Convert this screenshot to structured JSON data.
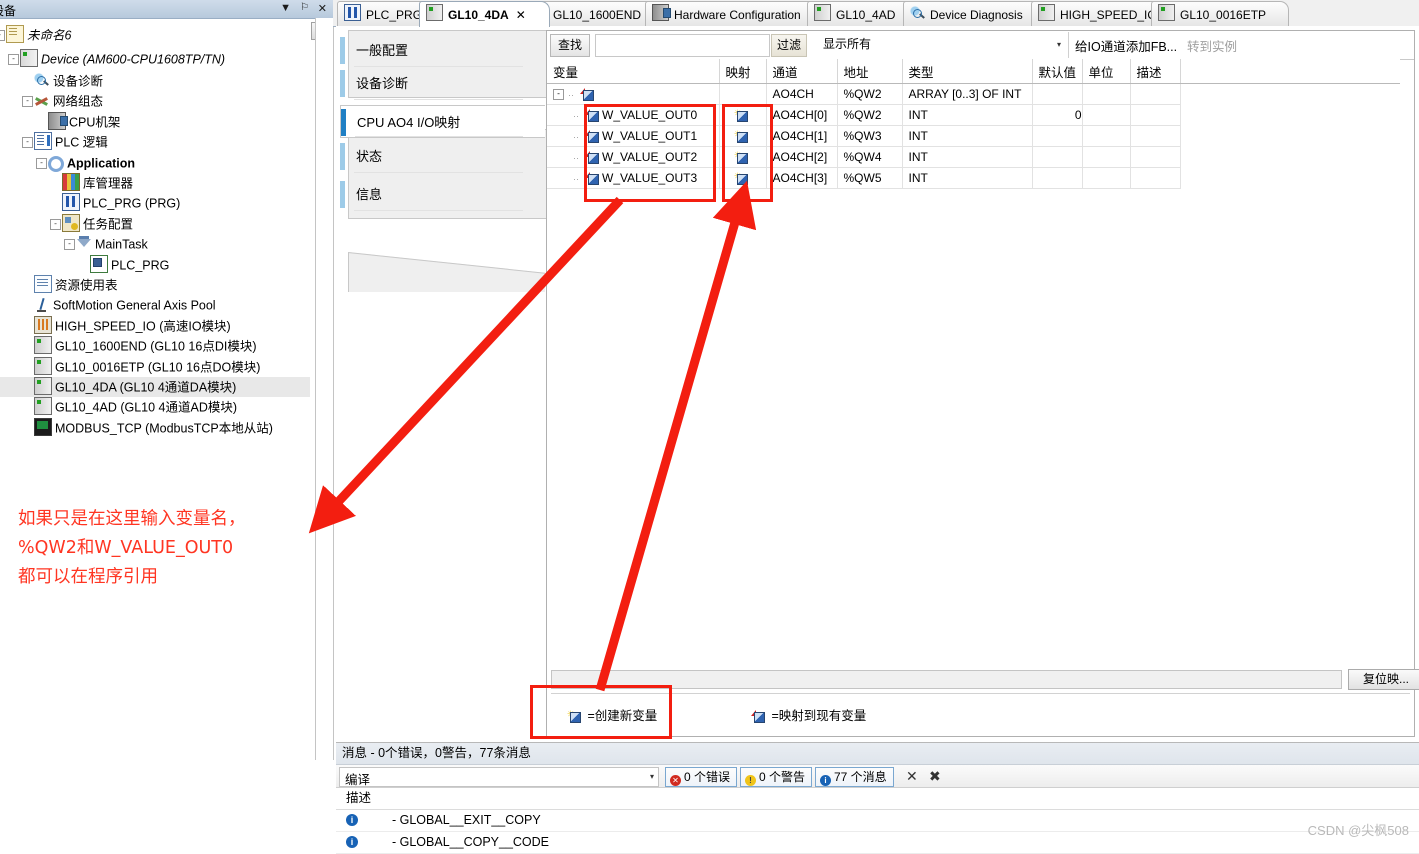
{
  "tree_panel": {
    "title": "设备",
    "controls": [
      "▼",
      "⚐",
      "✕"
    ],
    "scroll_button": "▼",
    "nodes": [
      {
        "label": "未命名6",
        "icon": "document-icon",
        "indent": 0,
        "expander": "-",
        "italic": true
      },
      {
        "label": "Device (AM600-CPU1608TP/TN)",
        "icon": "device-icon",
        "indent": 1,
        "expander": "-",
        "italic": true
      },
      {
        "label": "设备诊断",
        "icon": "diagnosis-magnifier-icon",
        "indent": 2,
        "expander": "",
        "italic": false
      },
      {
        "label": "网络组态",
        "icon": "network-config-icon",
        "indent": 2,
        "expander": "-",
        "italic": false
      },
      {
        "label": "CPU机架",
        "icon": "cpu-rack-icon",
        "indent": 3,
        "expander": "",
        "italic": false
      },
      {
        "label": "PLC 逻辑",
        "icon": "plc-logic-icon",
        "indent": 2,
        "expander": "-",
        "italic": false
      },
      {
        "label": "Application",
        "icon": "application-icon",
        "indent": 3,
        "expander": "-",
        "italic": false,
        "bold": true
      },
      {
        "label": "库管理器",
        "icon": "library-manager-icon",
        "indent": 4,
        "expander": "",
        "italic": false
      },
      {
        "label": "PLC_PRG (PRG)",
        "icon": "program-icon",
        "indent": 4,
        "expander": "",
        "italic": false
      },
      {
        "label": "任务配置",
        "icon": "task-config-icon",
        "indent": 4,
        "expander": "-",
        "italic": false
      },
      {
        "label": "MainTask",
        "icon": "main-task-icon",
        "indent": 5,
        "expander": "-",
        "italic": false
      },
      {
        "label": "PLC_PRG",
        "icon": "task-program-icon",
        "indent": 6,
        "expander": "",
        "italic": false
      },
      {
        "label": "资源使用表",
        "icon": "resource-table-icon",
        "indent": 2,
        "expander": "",
        "italic": false
      },
      {
        "label": "SoftMotion General Axis Pool",
        "icon": "axis-pool-icon",
        "indent": 2,
        "expander": "",
        "italic": false
      },
      {
        "label": "HIGH_SPEED_IO (高速IO模块)",
        "icon": "high-speed-io-icon",
        "indent": 2,
        "expander": "",
        "italic": false
      },
      {
        "label": "GL10_1600END (GL10 16点DI模块)",
        "icon": "module-icon",
        "indent": 2,
        "expander": "",
        "italic": false
      },
      {
        "label": "GL10_0016ETP (GL10 16点DO模块)",
        "icon": "module-icon",
        "indent": 2,
        "expander": "",
        "italic": false
      },
      {
        "label": "GL10_4DA (GL10 4通道DA模块)",
        "icon": "module-icon",
        "indent": 2,
        "expander": "",
        "italic": false,
        "selected": true
      },
      {
        "label": "GL10_4AD (GL10 4通道AD模块)",
        "icon": "module-icon",
        "indent": 2,
        "expander": "",
        "italic": false
      },
      {
        "label": "MODBUS_TCP (ModbusTCP本地从站)",
        "icon": "modbus-tcp-icon",
        "indent": 2,
        "expander": "",
        "italic": false
      }
    ]
  },
  "annotation": {
    "line1": "如果只是在这里输入变量名，",
    "line2": "%QW2和W_VALUE_OUT0",
    "line3": "都可以在程序引用",
    "color": "#ff3522"
  },
  "tabs": [
    {
      "label": "PLC_PRG",
      "icon": "program-icon",
      "active": false,
      "closable": false
    },
    {
      "label": "GL10_4DA",
      "icon": "module-icon",
      "active": true,
      "closable": true,
      "close_glyph": "✕"
    },
    {
      "label": "GL10_1600END",
      "icon": "module-icon",
      "active": false,
      "closable": false
    },
    {
      "label": "Hardware Configuration",
      "icon": "cpu-rack-icon",
      "active": false,
      "closable": false
    },
    {
      "label": "GL10_4AD",
      "icon": "module-icon",
      "active": false,
      "closable": false
    },
    {
      "label": "Device Diagnosis",
      "icon": "diagnosis-magnifier-icon",
      "active": false,
      "closable": false
    },
    {
      "label": "HIGH_SPEED_IO",
      "icon": "module-icon",
      "active": false,
      "closable": false
    },
    {
      "label": "GL10_0016ETP",
      "icon": "module-icon",
      "active": false,
      "closable": false
    }
  ],
  "categories": [
    {
      "label": "一般配置",
      "active": false
    },
    {
      "label": "设备诊断",
      "active": false
    },
    {
      "label": "CPU AO4 I/O映射",
      "active": true
    },
    {
      "label": "状态",
      "active": false
    },
    {
      "label": "信息",
      "active": false
    }
  ],
  "filterbar": {
    "find_label": "查找",
    "find_value": "",
    "find_placeholder": "",
    "filter_label": "过滤",
    "filter_value": "显示所有",
    "caret": "▾",
    "add_fb_label": "给IO通道添加FB...",
    "goto_instance_label": "转到实例"
  },
  "table": {
    "columns": [
      "变量",
      "映射",
      "通道",
      "地址",
      "类型",
      "默认值",
      "单位",
      "描述"
    ],
    "rows": [
      {
        "variable": "",
        "expander": "-",
        "icon": "map-variable-icon",
        "mapping": "",
        "channel": "AO4CH",
        "address": "%QW2",
        "type": "ARRAY [0..3] OF INT",
        "default": "",
        "unit": "",
        "description": "",
        "child": false
      },
      {
        "variable": "W_VALUE_OUT0",
        "expander": "",
        "icon": "map-variable-icon",
        "mapping": "new-variable-icon",
        "channel": "AO4CH[0]",
        "address": "%QW2",
        "type": "INT",
        "default": "0",
        "unit": "",
        "description": "",
        "child": true
      },
      {
        "variable": "W_VALUE_OUT1",
        "expander": "",
        "icon": "map-variable-icon",
        "mapping": "new-variable-icon",
        "channel": "AO4CH[1]",
        "address": "%QW3",
        "type": "INT",
        "default": "",
        "unit": "",
        "description": "",
        "child": true
      },
      {
        "variable": "W_VALUE_OUT2",
        "expander": "",
        "icon": "map-variable-icon",
        "mapping": "new-variable-icon",
        "channel": "AO4CH[2]",
        "address": "%QW4",
        "type": "INT",
        "default": "",
        "unit": "",
        "description": "",
        "child": true
      },
      {
        "variable": "W_VALUE_OUT3",
        "expander": "",
        "icon": "map-variable-icon",
        "mapping": "new-variable-icon",
        "channel": "AO4CH[3]",
        "address": "%QW5",
        "type": "INT",
        "default": "",
        "unit": "",
        "description": "",
        "child": true
      }
    ]
  },
  "legend": {
    "create_new": "=创建新变量",
    "map_existing": "=映射到现有变量"
  },
  "reset_button": "复位映...",
  "messages": {
    "title": "消息 - 0个错误，0警告，77条消息",
    "source": "编译",
    "source_caret": "▾",
    "error_count": "0 个错误",
    "warning_count": "0 个警告",
    "info_count": "77 个消息",
    "clear_icon": "✕",
    "clear_all_icon": "✖",
    "column_header": "描述",
    "rows": [
      {
        "severity": "info",
        "text": "- GLOBAL__EXIT__COPY"
      },
      {
        "severity": "info",
        "text": "- GLOBAL__COPY__CODE"
      }
    ]
  },
  "watermark": "CSDN @尖枫508"
}
